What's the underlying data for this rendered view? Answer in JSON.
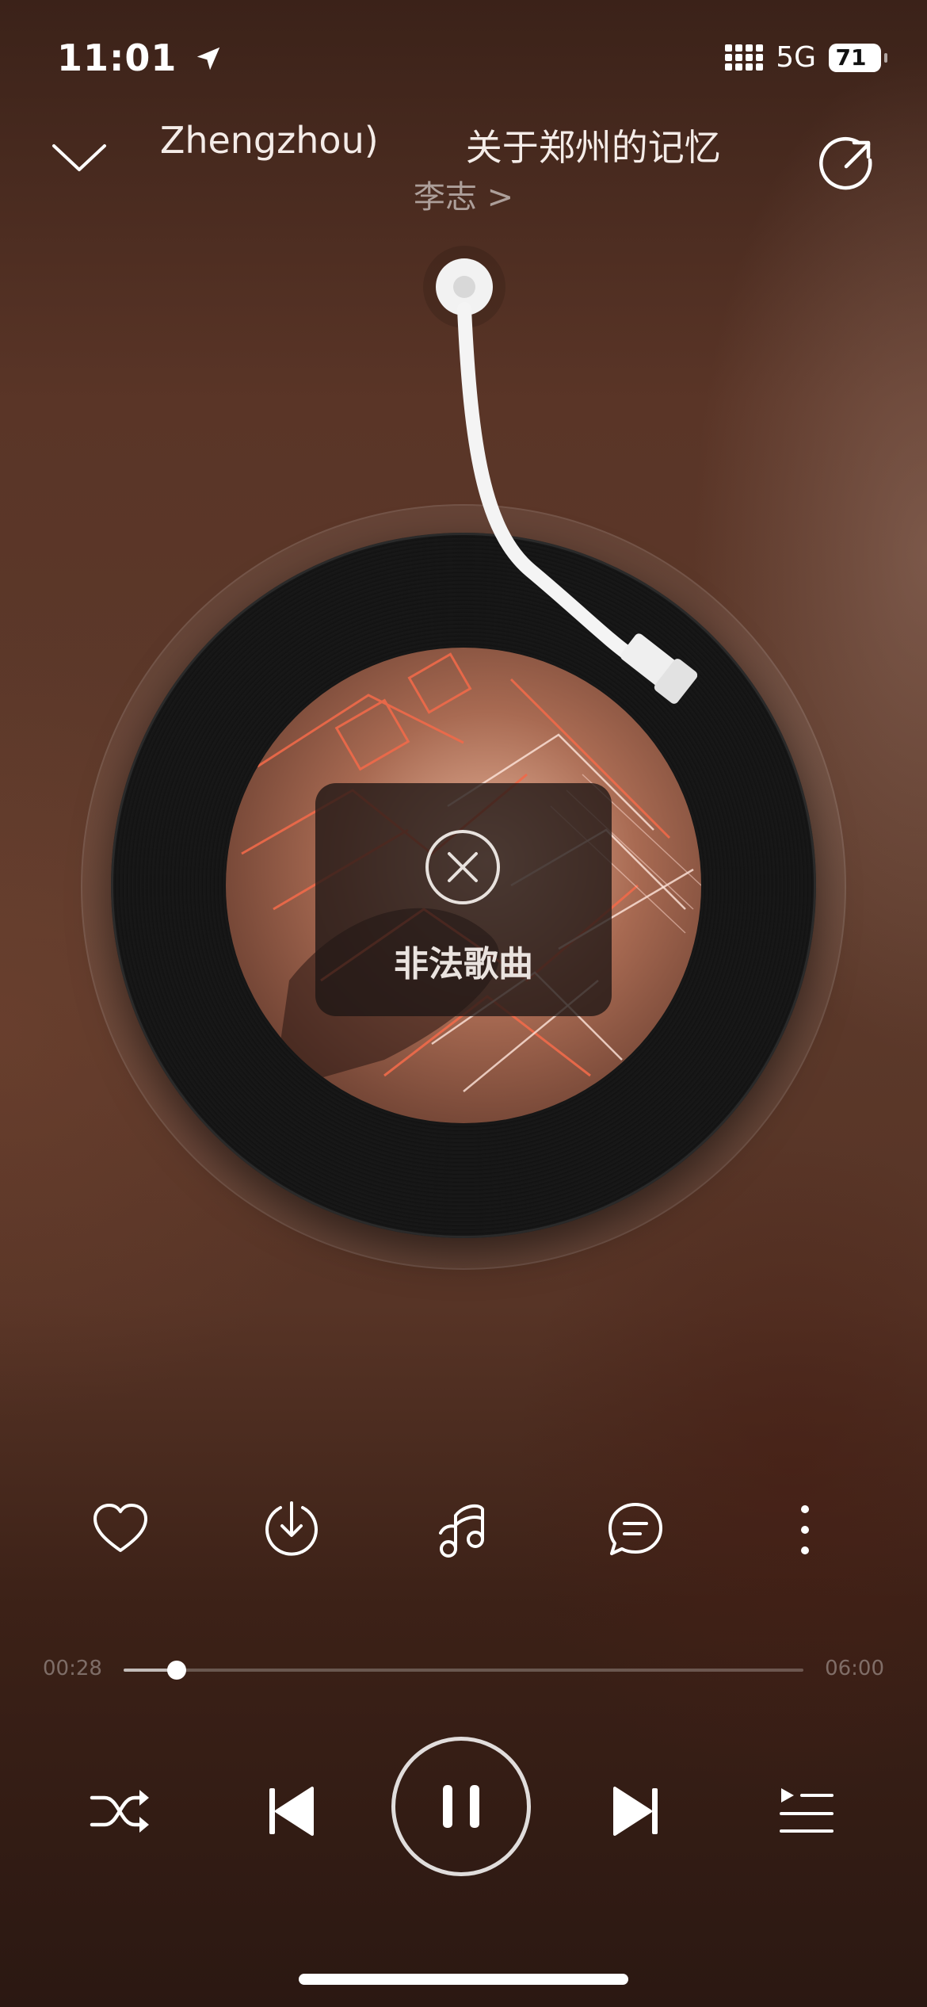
{
  "status_bar": {
    "time": "11:01",
    "network": "5G",
    "battery": "71"
  },
  "header": {
    "title_fragment": "ut Zhengzhou)",
    "title": "关于郑州的记忆",
    "artist": "李志 >"
  },
  "album": {
    "error_text": "非法歌曲"
  },
  "actions": [
    {
      "name": "like",
      "icon": "heart-icon"
    },
    {
      "name": "download",
      "icon": "download-icon"
    },
    {
      "name": "sound-effect",
      "icon": "music-note-icon"
    },
    {
      "name": "comments",
      "icon": "comment-icon"
    },
    {
      "name": "more",
      "icon": "more-vertical-icon"
    }
  ],
  "progress": {
    "current": "00:28",
    "total": "06:00",
    "fraction": 0.0778
  },
  "controls": {
    "shuffle": "shuffle-icon",
    "previous": "skip-previous-icon",
    "play_state": "pause-icon",
    "next": "skip-next-icon",
    "playlist": "playlist-icon"
  }
}
